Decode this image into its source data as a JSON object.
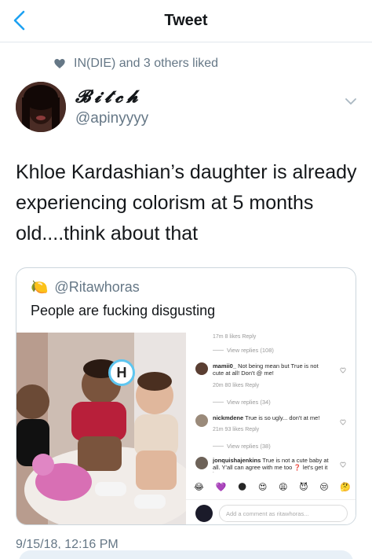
{
  "nav": {
    "title": "Tweet",
    "back_icon": "chevron-left-icon",
    "accent": "#1da1f2"
  },
  "social_context": {
    "text": "IN(DIE) and 3 others liked",
    "icon": "heart-icon"
  },
  "author": {
    "display_name": "𝓑𝓲𝓽𝓬𝓱",
    "handle": "@apinyyyy"
  },
  "tweet": {
    "text": "Khloe Kardashian’s daughter is already experiencing colorism at 5 months old....think about that"
  },
  "quote": {
    "emoji": "🍋",
    "handle": "@Ritawhoras",
    "text": "People are fucking disgusting",
    "photo_badge": "H",
    "comments": {
      "top_meta": "17m   8 likes   Reply",
      "view_replies_1": "View replies (108)",
      "items": [
        {
          "user": "mamii0_",
          "text": "Not being mean but True is not cute at all! Don't @ me!",
          "meta": "20m   80 likes   Reply"
        },
        {
          "user": "nickmdene",
          "text": "True is so ugly... don't at me!",
          "meta": "21m   93 likes   Reply"
        },
        {
          "user": "jonquishajenkins",
          "text": "True is not a cute baby at all. Y'all can agree with me too ❓ let's get it here",
          "meta": ""
        }
      ],
      "view_replies_2": "View replies (34)",
      "view_replies_3": "View replies (38)",
      "emojis": [
        "😂",
        "💜",
        "🌑",
        "😍",
        "😩",
        "😈",
        "😒",
        "🤔"
      ],
      "input_placeholder": "Add a comment as ritawhoras..."
    }
  },
  "timestamp": "9/15/18, 12:16 PM"
}
